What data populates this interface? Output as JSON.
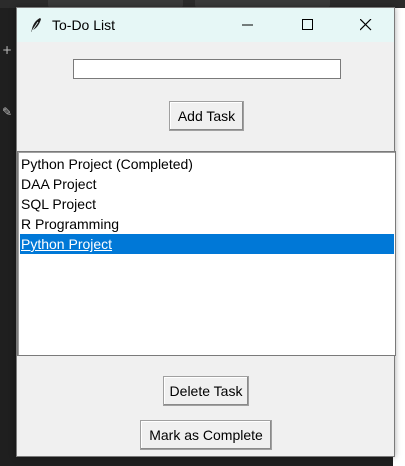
{
  "window": {
    "title": "To-Do List"
  },
  "task_entry": {
    "value": "",
    "placeholder": ""
  },
  "buttons": {
    "add_task": "Add Task",
    "delete_task": "Delete Task",
    "mark_complete": "Mark as Complete"
  },
  "tasks": [
    {
      "label": "Python Project (Completed)",
      "selected": false
    },
    {
      "label": "DAA Project",
      "selected": false
    },
    {
      "label": "SQL Project",
      "selected": false
    },
    {
      "label": "R Programming",
      "selected": false
    },
    {
      "label": "Python Project",
      "selected": true
    }
  ],
  "colors": {
    "selection": "#0078d7",
    "titlebar": "#e6f7f6"
  }
}
